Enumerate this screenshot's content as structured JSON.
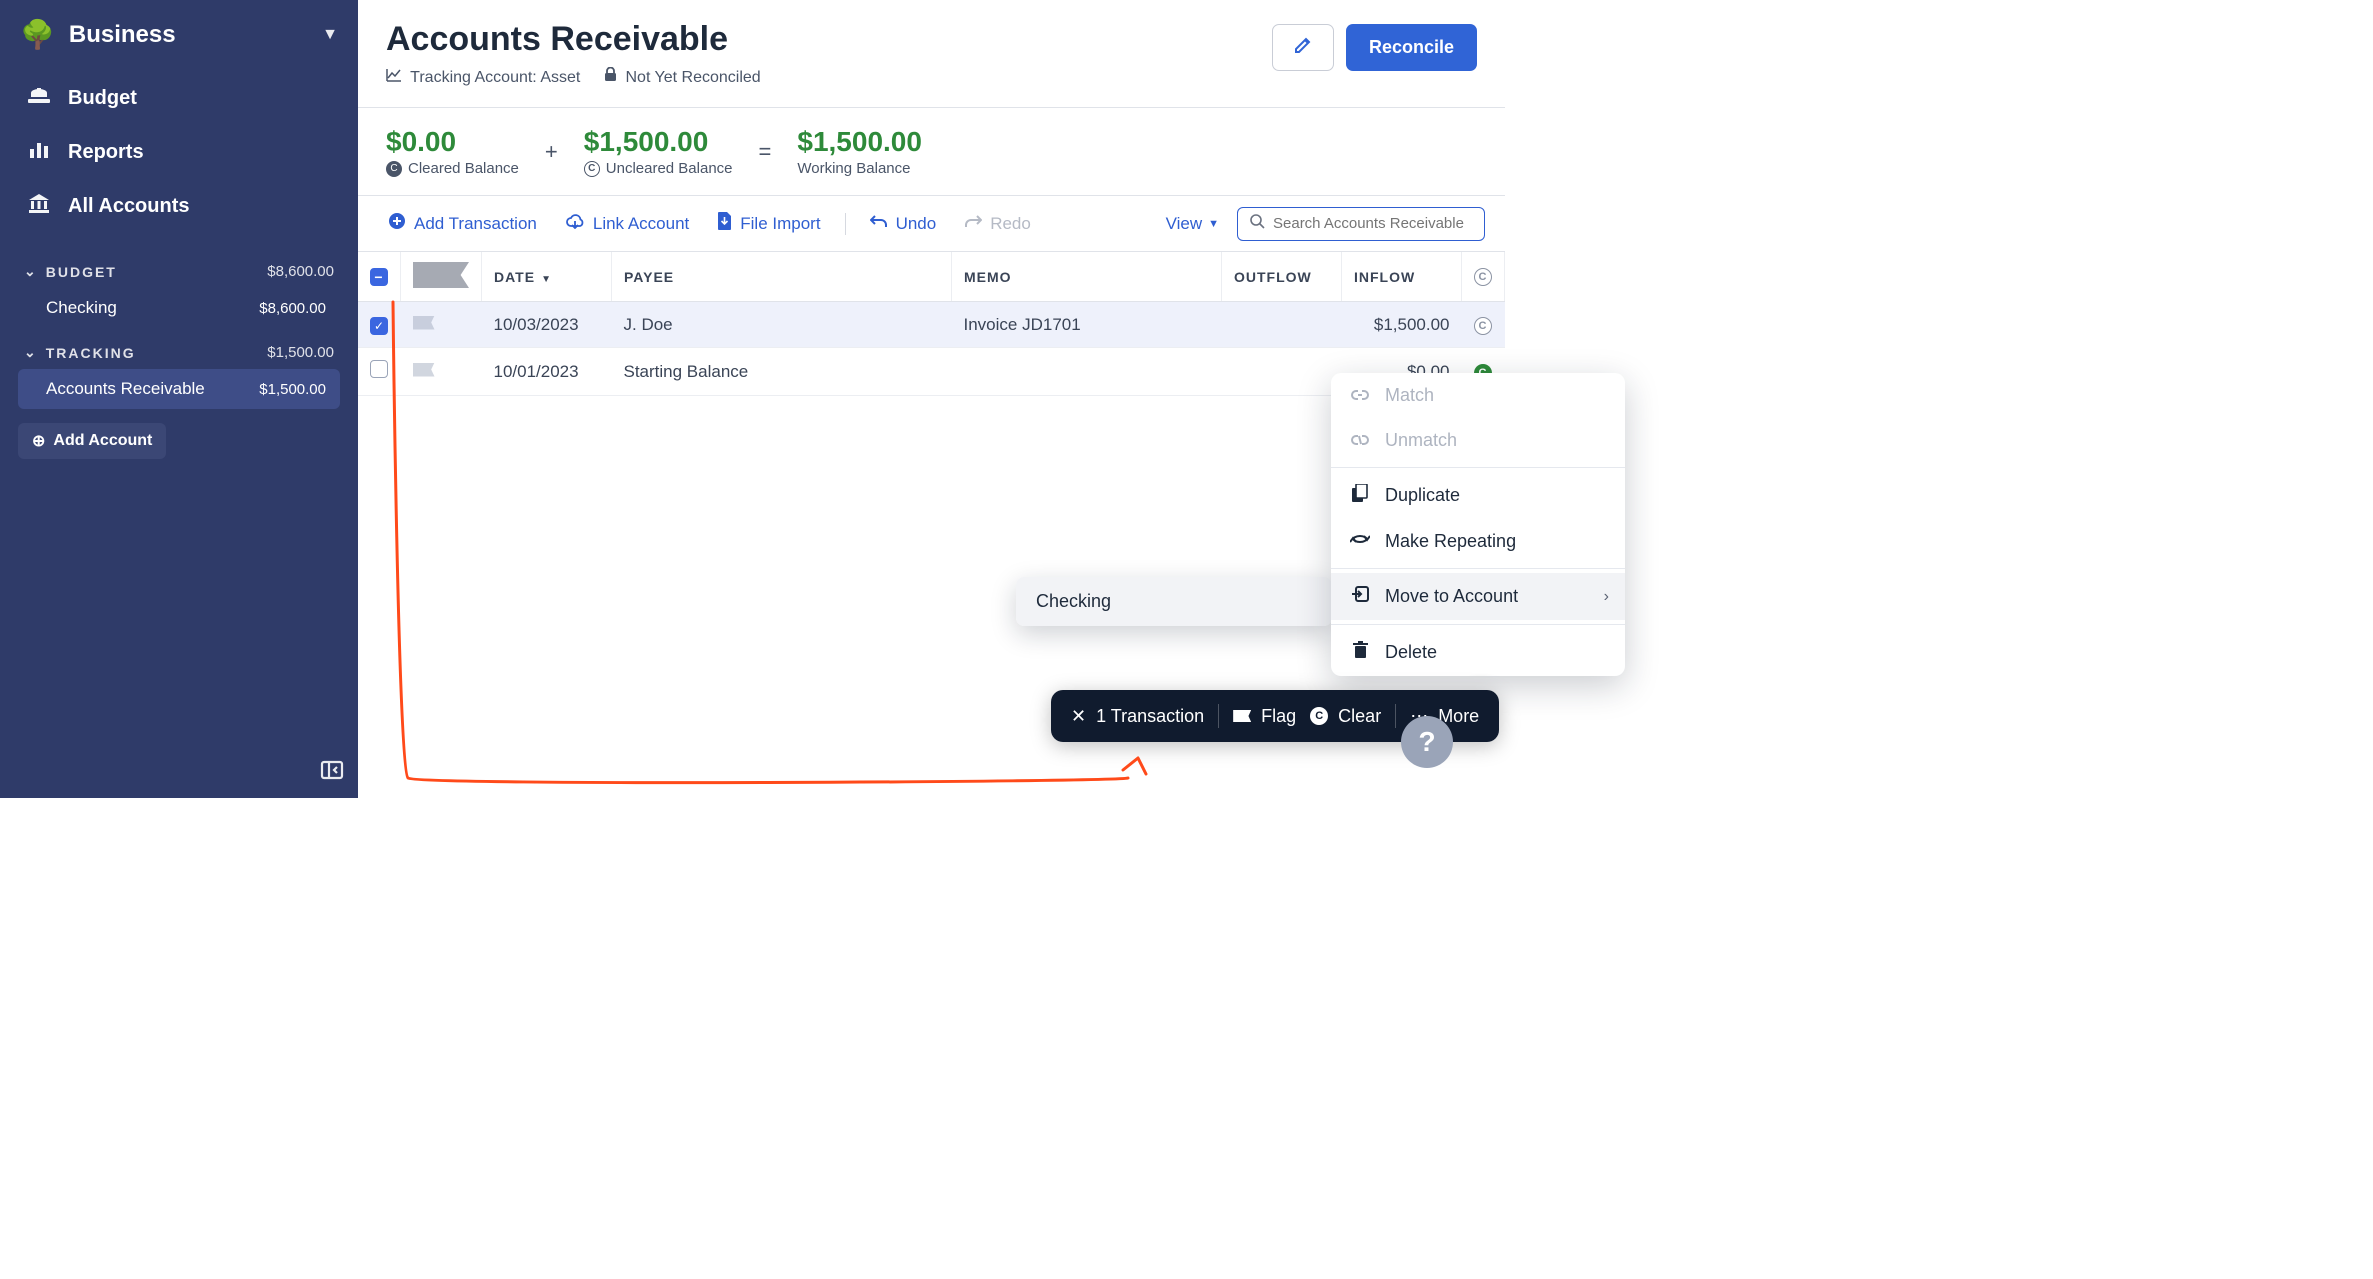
{
  "sidebar": {
    "workspace_name": "Business",
    "nav": {
      "budget": "Budget",
      "reports": "Reports",
      "all_accounts": "All Accounts"
    },
    "sections": [
      {
        "label": "BUDGET",
        "total": "$8,600.00",
        "accounts": [
          {
            "name": "Checking",
            "balance": "$8,600.00",
            "selected": false
          }
        ]
      },
      {
        "label": "TRACKING",
        "total": "$1,500.00",
        "accounts": [
          {
            "name": "Accounts Receivable",
            "balance": "$1,500.00",
            "selected": true
          }
        ]
      }
    ],
    "add_account": "Add Account"
  },
  "header": {
    "title": "Accounts Receivable",
    "sub_tracking": "Tracking Account: Asset",
    "sub_reconcile": "Not Yet Reconciled",
    "reconcile_btn": "Reconcile"
  },
  "balances": {
    "cleared_value": "$0.00",
    "cleared_label": "Cleared Balance",
    "uncleared_value": "$1,500.00",
    "uncleared_label": "Uncleared Balance",
    "working_value": "$1,500.00",
    "working_label": "Working Balance"
  },
  "toolbar": {
    "add": "Add Transaction",
    "link": "Link Account",
    "import": "File Import",
    "undo": "Undo",
    "redo": "Redo",
    "view": "View",
    "search_placeholder": "Search Accounts Receivable"
  },
  "columns": {
    "date": "DATE",
    "payee": "PAYEE",
    "memo": "MEMO",
    "outflow": "OUTFLOW",
    "inflow": "INFLOW"
  },
  "rows": [
    {
      "checked": true,
      "date": "10/03/2023",
      "payee": "J. Doe",
      "memo": "Invoice JD1701",
      "outflow": "",
      "inflow": "$1,500.00",
      "cleared": "outline"
    },
    {
      "checked": false,
      "date": "10/01/2023",
      "payee": "Starting Balance",
      "memo": "",
      "outflow": "",
      "inflow": "$0.00",
      "cleared": "solid"
    }
  ],
  "action_bar": {
    "count": "1 Transaction",
    "flag": "Flag",
    "clear": "Clear",
    "more": "More"
  },
  "context_menu": {
    "match": "Match",
    "unmatch": "Unmatch",
    "duplicate": "Duplicate",
    "make_repeating": "Make Repeating",
    "move_to_account": "Move to Account",
    "delete": "Delete"
  },
  "submenu": {
    "option": "Checking"
  }
}
